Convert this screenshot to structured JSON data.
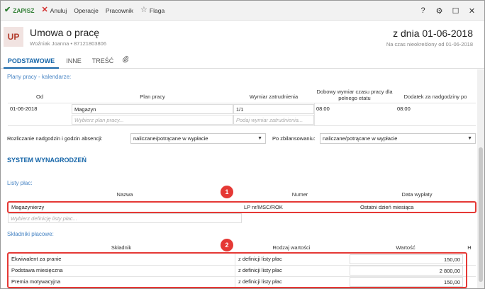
{
  "toolbar": {
    "save": "ZAPISZ",
    "cancel": "Anuluj",
    "operations": "Operacje",
    "employee": "Pracownik",
    "flag": "Flaga",
    "help": "?",
    "settings_icon": "gear-icon",
    "maximize_icon": "maximize-icon",
    "close_icon": "close-icon"
  },
  "header": {
    "avatar": "UP",
    "title": "Umowa o pracę",
    "subtitle": "Woźniak Joanna  •  87121803806",
    "date": "z dnia 01-06-2018",
    "period": "Na czas nieokreślony od 01-06-2018"
  },
  "tabs": [
    {
      "label": "PODSTAWOWE",
      "active": true
    },
    {
      "label": "INNE",
      "active": false
    },
    {
      "label": "TREŚĆ",
      "active": false
    },
    {
      "label": "",
      "icon": "paperclip-icon",
      "active": false
    }
  ],
  "plans": {
    "section_label": "Plany pracy - kalendarze:",
    "headers": [
      "Od",
      "Plan pracy",
      "Wymiar zatrudnienia",
      "Dobowy wymiar czasu pracy dla pełnego etatu",
      "Dodatek za nadgodziny po"
    ],
    "row": {
      "from": "01-06-2018",
      "plan": "Magazyn",
      "dimension": "1/1",
      "daily": "08:00",
      "overtime": "08:00"
    },
    "plan_placeholder": "Wybierz plan pracy...",
    "dimension_placeholder": "Podaj wymiar zatrudnienia..."
  },
  "settlement": {
    "overtime_label": "Rozliczanie nadgodzin i godzin absencji:",
    "overtime_value": "naliczane/potrącane w wypłacie",
    "balance_label": "Po zbilansowaniu:",
    "balance_value": "naliczane/potrącane w wypłacie"
  },
  "salary_system": {
    "heading": "SYSTEM WYNAGRODZEŃ",
    "payroll_label": "Listy płac:",
    "payroll_headers": [
      "Nazwa",
      "Numer",
      "Data wypłaty"
    ],
    "payroll_row": {
      "name": "Magazynierzy",
      "number": "LP nr/MSC/ROK",
      "payday": "Ostatni dzień miesiąca"
    },
    "payroll_placeholder": "Wybierz definicję listy płac...",
    "components_label": "Składniki płacowe:",
    "components_headers": [
      "Składnik",
      "Rodzaj wartości",
      "Wartość",
      "H"
    ],
    "components": [
      {
        "name": "Ekwiwalent za pranie",
        "type": "z definicji listy płac",
        "value": "150,00"
      },
      {
        "name": "Podstawa miesięczna",
        "type": "z definicji listy płac",
        "value": "2 800,00"
      },
      {
        "name": "Premia motywacyjna",
        "type": "z definicji listy płac",
        "value": "150,00"
      }
    ]
  },
  "annotations": {
    "badge1": "1",
    "badge2": "2"
  },
  "colors": {
    "accent": "#1565a8",
    "highlight": "#e53935",
    "save": "#2e7d32"
  }
}
